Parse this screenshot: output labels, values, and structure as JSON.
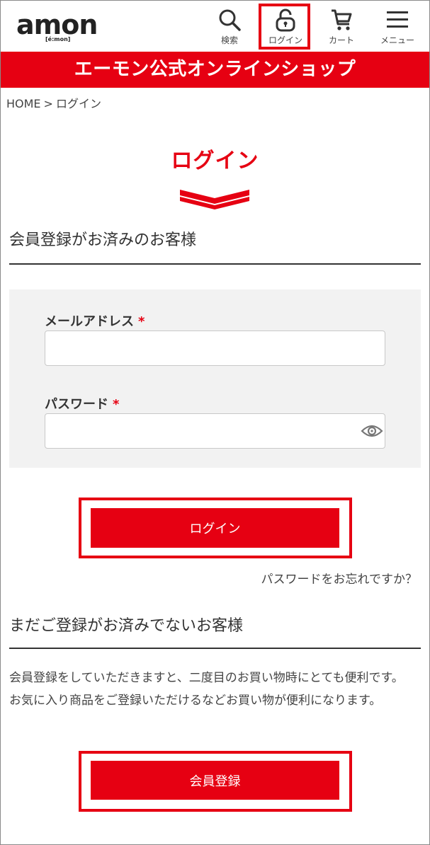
{
  "header": {
    "logo_text": "amon",
    "logo_sub": "[é:mon]",
    "nav": {
      "search": "検索",
      "login": "ログイン",
      "cart": "カート",
      "menu": "メニュー"
    }
  },
  "banner": "エーモン公式オンラインショップ",
  "breadcrumb": {
    "home": "HOME",
    "sep": ">",
    "current": "ログイン"
  },
  "page_title": "ログイン",
  "member_section": {
    "title": "会員登録がお済みのお客様",
    "email_label": "メールアドレス",
    "password_label": "パスワード",
    "required_mark": "*",
    "email_value": "",
    "password_value": "",
    "login_button": "ログイン",
    "forgot_link": "パスワードをお忘れですか？"
  },
  "guest_section": {
    "title": "まだご登録がお済みでないお客様",
    "description_line1": "会員登録をしていただきますと、二度目のお買い物時にとても便利です。",
    "description_line2": "お気に入り商品をご登録いただけるなどお買い物が便利になります。",
    "register_button": "会員登録"
  },
  "colors": {
    "brand_red": "#e60012",
    "panel_bg": "#f2f2f2"
  }
}
